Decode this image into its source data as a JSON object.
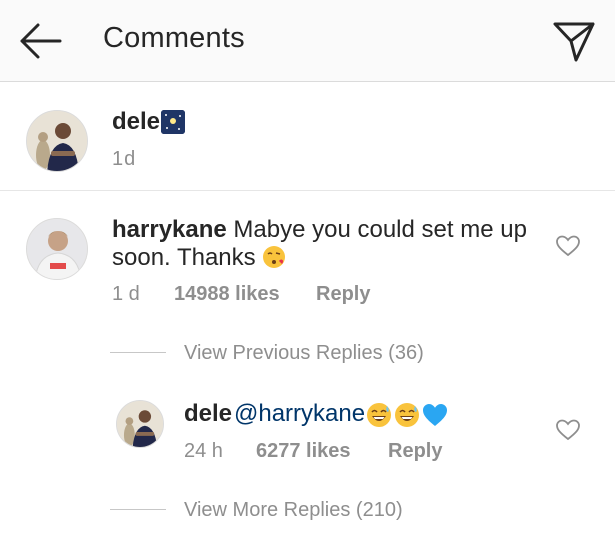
{
  "header": {
    "title": "Comments",
    "back_icon": "arrow-left-icon",
    "send_icon": "paper-plane-icon"
  },
  "caption": {
    "username": "dele",
    "emoji": "night-sky-emoji",
    "time": "1d"
  },
  "comment": {
    "username": "harrykane",
    "text": "Mabye you could set me up soon. Thanks",
    "emoji": "kissing-face-emoji",
    "time": "1 d",
    "likes": "14988 likes",
    "reply_label": "Reply",
    "heart_icon": "heart-outline-icon"
  },
  "view_previous": {
    "label": "View Previous Replies (36)"
  },
  "reply": {
    "username": "dele",
    "mention": "@harrykane",
    "emojis": [
      "grinning-sweat-emoji",
      "grinning-sweat-emoji",
      "blue-heart-emoji"
    ],
    "time": "24 h",
    "likes": "6277 likes",
    "reply_label": "Reply",
    "heart_icon": "heart-outline-icon"
  },
  "view_more": {
    "label": "View More Replies (210)"
  },
  "colors": {
    "text": "#262626",
    "secondary": "#8e8e8e",
    "mention": "#003569",
    "header_bg": "#fafafa",
    "divider": "#dbdbdb"
  }
}
